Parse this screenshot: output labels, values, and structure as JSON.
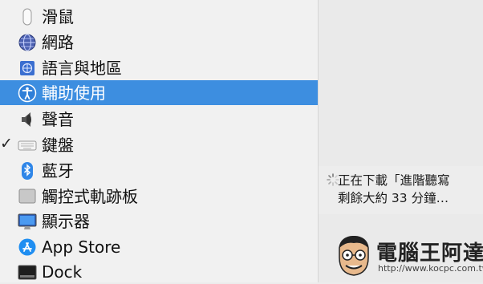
{
  "menu": {
    "items": [
      {
        "label": "滑鼠",
        "icon": "mouse-icon",
        "checked": false,
        "selected": false
      },
      {
        "label": "網路",
        "icon": "globe-network-icon",
        "checked": false,
        "selected": false
      },
      {
        "label": "語言與地區",
        "icon": "flag-icon",
        "checked": false,
        "selected": false
      },
      {
        "label": "輔助使用",
        "icon": "accessibility-icon",
        "checked": false,
        "selected": true
      },
      {
        "label": "聲音",
        "icon": "speaker-icon",
        "checked": false,
        "selected": false
      },
      {
        "label": "鍵盤",
        "icon": "keyboard-icon",
        "checked": true,
        "selected": false
      },
      {
        "label": "藍牙",
        "icon": "bluetooth-icon",
        "checked": false,
        "selected": false
      },
      {
        "label": "觸控式軌跡板",
        "icon": "trackpad-icon",
        "checked": false,
        "selected": false
      },
      {
        "label": "顯示器",
        "icon": "display-icon",
        "checked": false,
        "selected": false
      },
      {
        "label": "App Store",
        "icon": "app-store-icon",
        "checked": false,
        "selected": false
      },
      {
        "label": "Dock",
        "icon": "dock-icon",
        "checked": false,
        "selected": false
      }
    ],
    "check_mark": "✓"
  },
  "download": {
    "line1": "正在下載「進階聽寫",
    "line2": "剩餘大約 33 分鐘…"
  },
  "watermark": {
    "title": "電腦王阿達",
    "url": "http://www.kocpc.com.tw"
  },
  "colors": {
    "selection": "#3d8ee0",
    "menu_bg": "#f1f1f1"
  }
}
